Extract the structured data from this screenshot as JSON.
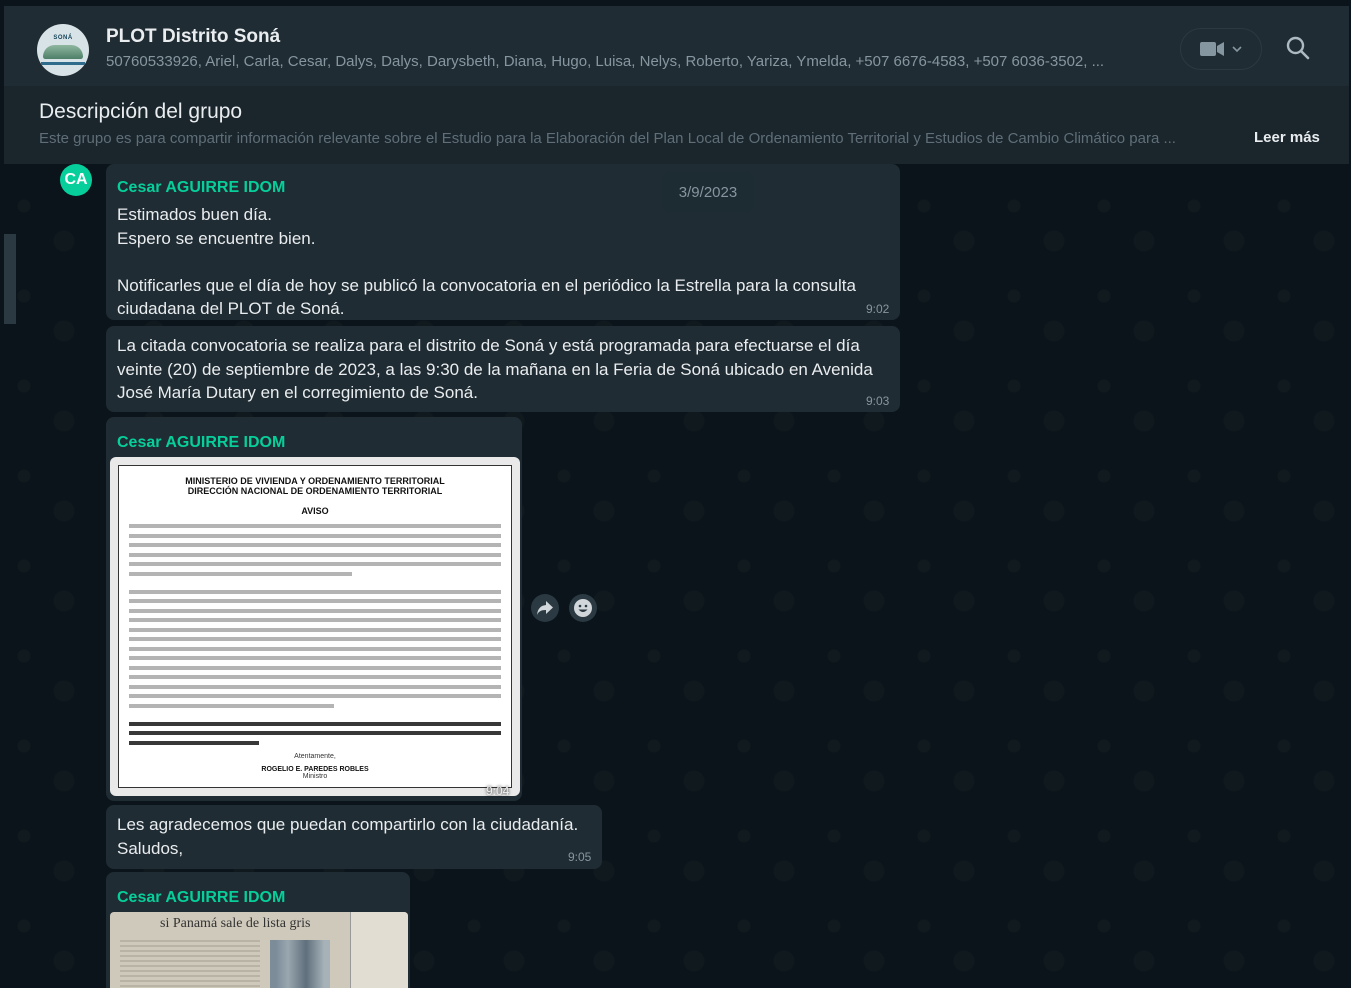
{
  "header": {
    "avatar_text": "SONÁ",
    "title": "PLOT Distrito Soná",
    "members": "50760533926, Ariel, Carla, Cesar, Dalys, Dalys, Darysbeth, Diana, Hugo, Luisa, Nelys, Roberto, Yariza, Ymelda, +507 6676-4583, +507 6036-3502, ..."
  },
  "description": {
    "title": "Descripción del grupo",
    "text": "Este grupo es para compartir información relevante sobre el Estudio para la Elaboración del Plan Local de Ordenamiento Territorial y Estudios de Cambio Climático para ...",
    "read_more": "Leer más"
  },
  "date_chip": "3/9/2023",
  "messages": [
    {
      "avatar": "CA",
      "sender": "Cesar AGUIRRE IDOM",
      "lines": [
        "Estimados buen día.",
        "Espero se encuentre bien.",
        "",
        "Notificarles que el día de hoy se publicó la convocatoria en el periódico la Estrella para la consulta",
        "ciudadana del PLOT de Soná."
      ],
      "time": "9:02"
    },
    {
      "lines": [
        "La citada convocatoria se realiza para el distrito de Soná y está programada para efectuarse el día",
        "veinte (20) de septiembre de 2023, a las 9:30 de la mañana en la Feria de Soná ubicado en Avenida",
        "José María Dutary en el corregimiento de Soná."
      ],
      "time": "9:03"
    },
    {
      "sender": "Cesar AGUIRRE IDOM",
      "image": {
        "heading1": "MINISTERIO DE VIVIENDA Y ORDENAMIENTO TERRITORIAL",
        "heading2": "DIRECCIÓN NACIONAL DE ORDENAMIENTO TERRITORIAL",
        "aviso": "AVISO",
        "closing": "Atentamente,",
        "signer": "ROGELIO E. PAREDES ROBLES",
        "role": "Ministro"
      },
      "time": "9:04"
    },
    {
      "lines": [
        "Les agradecemos que puedan compartirlo  con la ciudadanía.",
        "Saludos,"
      ],
      "time": "9:05"
    },
    {
      "sender": "Cesar AGUIRRE IDOM",
      "image": {
        "headline": "si Panamá sale de lista gris"
      }
    }
  ]
}
